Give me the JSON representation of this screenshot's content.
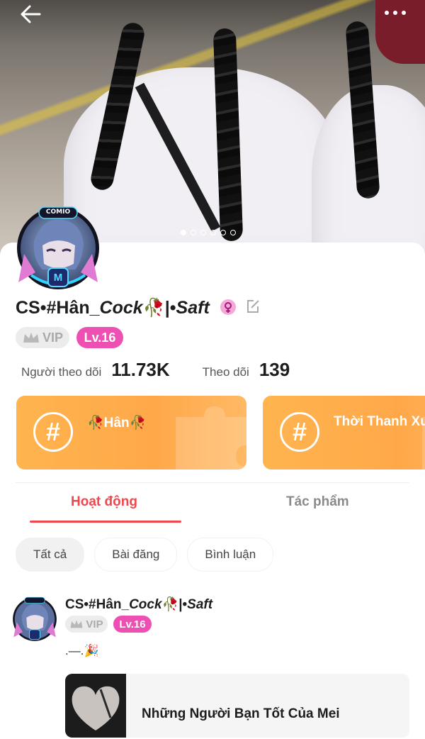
{
  "profile": {
    "username_a": "CS•#Hân_",
    "username_b": "Cock",
    "username_c": "🥀|•",
    "username_d": "Saft",
    "vip_label": "VIP",
    "level": "Lv.16",
    "followers_label": "Người theo dõi",
    "followers_value": "11.73K",
    "following_label": "Theo dõi",
    "following_value": "139",
    "avatar_badge": "COMIO"
  },
  "cover": {
    "page_count": 6,
    "active_index": 0
  },
  "groups": [
    {
      "name": "🥀Hân🥀"
    },
    {
      "name": "Thời Thanh Xuân"
    }
  ],
  "tabs": [
    {
      "label": "Hoạt động",
      "active": true
    },
    {
      "label": "Tác phẩm",
      "active": false
    }
  ],
  "filters": [
    {
      "label": "Tất cả",
      "active": true
    },
    {
      "label": "Bài đăng",
      "active": false
    },
    {
      "label": "Bình luận",
      "active": false
    }
  ],
  "post": {
    "author_a": "CS•#Hân_",
    "author_b": "Cock",
    "author_c": "🥀|•",
    "author_d": "Saft",
    "vip_label": "VIP",
    "level": "Lv.16",
    "text": ".—.🎉",
    "shared_title": "Những Người Bạn Tốt Của Mei"
  },
  "icons": {
    "back": "arrow-left-icon",
    "more": "more-horizontal-icon",
    "gender": "female-icon",
    "edit": "edit-icon",
    "crown": "crown-icon",
    "hash": "hashtag-icon"
  },
  "colors": {
    "accent": "#f2464f",
    "level_badge": "#ee4fb2",
    "group_card": "#ffab4a",
    "vip_badge": "#ececec"
  }
}
